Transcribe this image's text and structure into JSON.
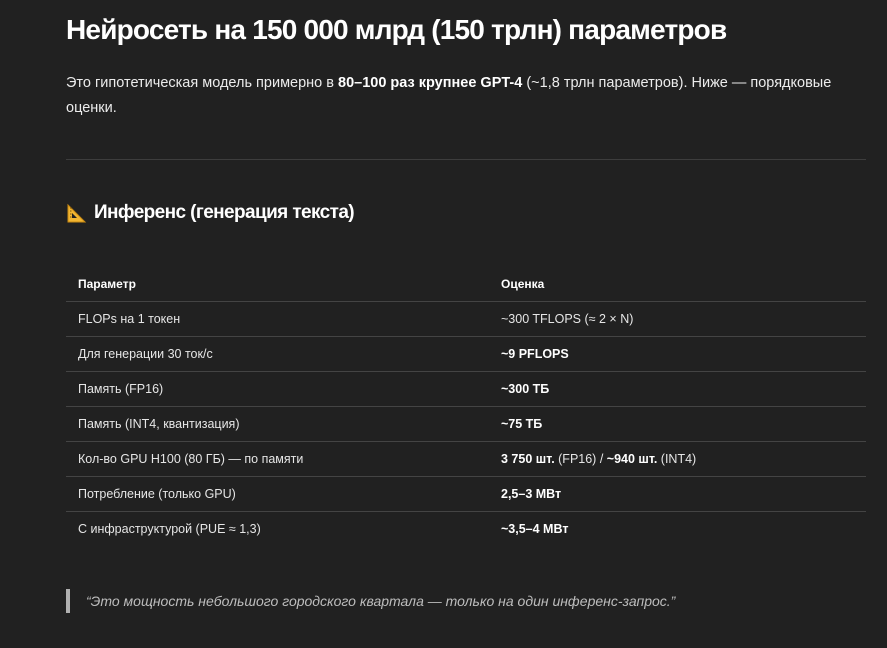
{
  "title": "Нейросеть на 150 000 млрд (150 трлн) параметров",
  "intro": {
    "part1": "Это гипотетическая модель примерно в ",
    "bold1": "80–100 раз крупнее GPT-4",
    "part2": " (~1,8 трлн параметров). Ниже — порядковые оценки."
  },
  "section": {
    "icon": "triangular-ruler-icon",
    "heading": "Инференс (генерация текста)"
  },
  "table": {
    "headers": [
      "Параметр",
      "Оценка"
    ],
    "rows": [
      {
        "param": "FLOPs на 1 токен",
        "est": [
          {
            "t": "~300 TFLOPS (≈ 2 × N)",
            "b": false
          }
        ]
      },
      {
        "param": "Для генерации 30 ток/с",
        "est": [
          {
            "t": "~9 PFLOPS",
            "b": true
          }
        ]
      },
      {
        "param": "Память (FP16)",
        "est": [
          {
            "t": "~300 ТБ",
            "b": true
          }
        ]
      },
      {
        "param": "Память (INT4, квантизация)",
        "est": [
          {
            "t": "~75 ТБ",
            "b": true
          }
        ]
      },
      {
        "param": "Кол-во GPU H100 (80 ГБ) — по памяти",
        "est": [
          {
            "t": "3 750 шт.",
            "b": true
          },
          {
            "t": " (FP16) / ",
            "b": false
          },
          {
            "t": "~940 шт.",
            "b": true
          },
          {
            "t": " (INT4)",
            "b": false
          }
        ]
      },
      {
        "param": "Потребление (только GPU)",
        "est": [
          {
            "t": "2,5–3 МВт",
            "b": true
          }
        ]
      },
      {
        "param": "С инфраструктурой (PUE ≈ 1,3)",
        "est": [
          {
            "t": "~3,5–4 МВт",
            "b": true
          }
        ]
      }
    ]
  },
  "quote": "“Это мощность небольшого городского квартала — только на один инференс-запрос.”"
}
